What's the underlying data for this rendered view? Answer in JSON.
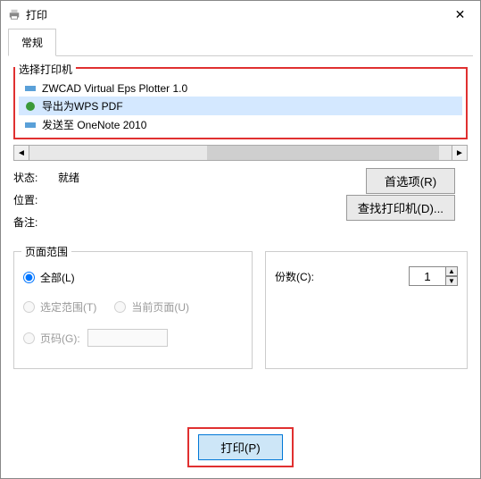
{
  "titlebar": {
    "title": "打印"
  },
  "tabs": {
    "general": "常规"
  },
  "printers": {
    "label": "选择打印机",
    "items": [
      {
        "name": "ZWCAD Virtual Eps Plotter 1.0"
      },
      {
        "name": "导出为WPS PDF"
      },
      {
        "name": "发送至 OneNote 2010"
      }
    ]
  },
  "status": {
    "label": "状态:",
    "value": "就绪"
  },
  "location": {
    "label": "位置:"
  },
  "note": {
    "label": "备注:"
  },
  "buttons": {
    "preferences": "首选项(R)",
    "find_printer": "查找打印机(D)...",
    "print": "打印(P)"
  },
  "range": {
    "label": "页面范围",
    "all": "全部(L)",
    "selection": "选定范围(T)",
    "current": "当前页面(U)",
    "pages": "页码(G):"
  },
  "copies": {
    "label": "份数(C):",
    "value": "1"
  }
}
